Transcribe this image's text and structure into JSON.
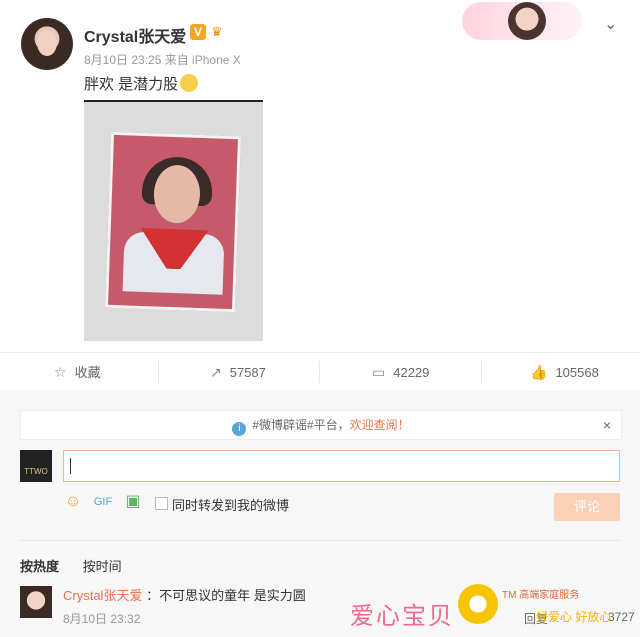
{
  "post": {
    "username": "Crystal张天爱",
    "verified_badge": "V",
    "meta": "8月10日 23:25 来自 iPhone X",
    "text": "胖欢 是潜力股"
  },
  "actions": {
    "favorite": "收藏",
    "repost_count": "57587",
    "comment_count": "42229",
    "like_count": "105568"
  },
  "notice": {
    "prefix": "#微博辟谣#平台，",
    "link": "欢迎查阅！",
    "close": "×"
  },
  "composer": {
    "my_avatar_text": "TTWO",
    "sync_label": "同时转发到我的微博",
    "submit_label": "评论"
  },
  "sort": {
    "hot": "按热度",
    "time": "按时间"
  },
  "comment": {
    "name": "Crystal张天爱",
    "text": "：不可思议的童年 是实力圆",
    "date": "8月10日 23:32",
    "reply": "回复",
    "likes": "3727"
  },
  "watermark": {
    "text": "爱心宝贝",
    "tm": "TM 高端家庭服务",
    "sub": "好爱心 好放心"
  },
  "icons": [
    "star-icon",
    "repost-icon",
    "comment-icon",
    "like-icon",
    "info-icon",
    "close-icon",
    "emoji-icon",
    "gif-icon",
    "image-icon",
    "chevron-down-icon"
  ],
  "colors": {
    "accent": "#eb7350",
    "submit_bg": "#fbd0b6",
    "link": "#eb7350"
  }
}
